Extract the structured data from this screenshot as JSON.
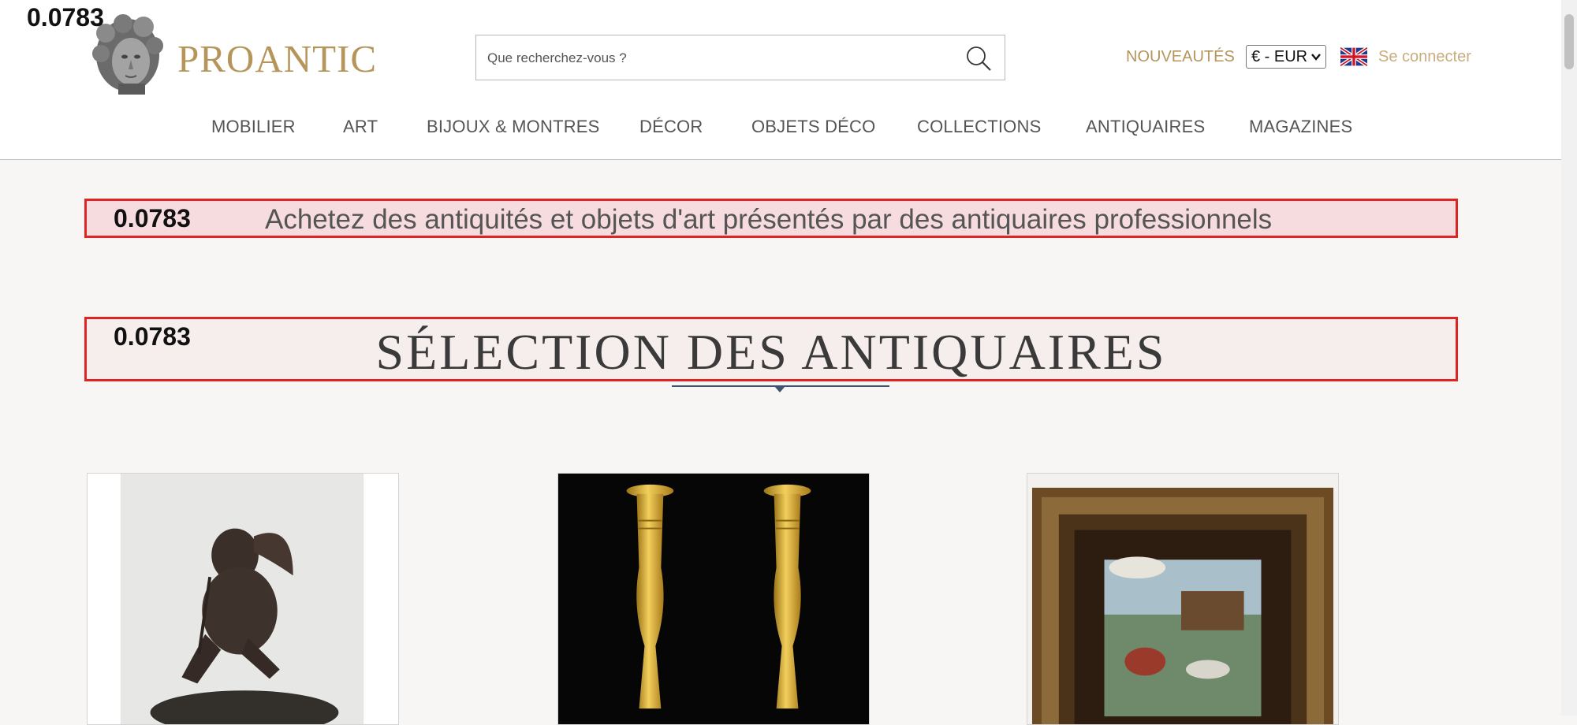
{
  "overlay": {
    "score_label": "0.0783"
  },
  "header": {
    "brand": "PROANTIC",
    "search_placeholder": "Que recherchez-vous ?",
    "nouveautes": "NOUVEAUTÉS",
    "currency": "€ - EUR",
    "login": "Se connecter",
    "language_flag": "uk-flag-icon"
  },
  "nav": {
    "items": [
      "MOBILIER",
      "ART",
      "BIJOUX & MONTRES",
      "DÉCOR",
      "OBJETS DÉCO",
      "COLLECTIONS",
      "ANTIQUAIRES",
      "MAGAZINES"
    ]
  },
  "banner": {
    "score": "0.0783",
    "text": "Achetez des antiquités et objets d'art présentés par des antiquaires professionnels"
  },
  "section": {
    "score": "0.0783",
    "title": "SÉLECTION DES ANTIQUAIRES"
  },
  "products": [
    {
      "image": "bronze-cupid-sculpture"
    },
    {
      "image": "gilt-bronze-candlesticks"
    },
    {
      "image": "framed-pastoral-painting"
    }
  ],
  "colors": {
    "accent_gold": "#b5955a",
    "highlight_red": "#e02424",
    "nav_text": "#555555"
  }
}
